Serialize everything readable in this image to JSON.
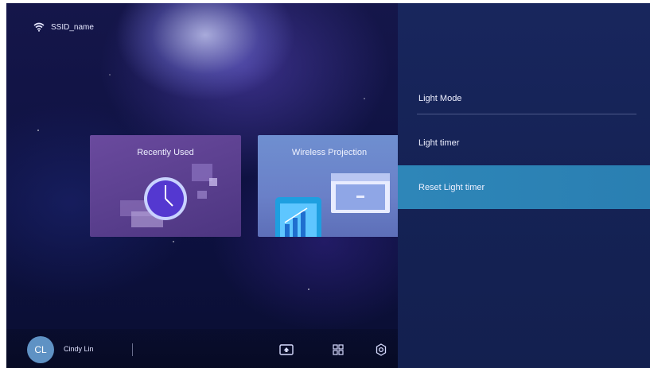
{
  "status_bar": {
    "wifi_icon": "wifi-icon",
    "ssid": "SSID_name"
  },
  "home": {
    "tiles": [
      {
        "title": "Recently Used",
        "icon": "clock-icon"
      },
      {
        "title": "Wireless Projection",
        "icon": "phone-projection-icon"
      }
    ]
  },
  "bottom_bar": {
    "user": {
      "initials": "CL",
      "name": "Cindy Lin"
    },
    "icons": [
      "input-source-icon",
      "apps-grid-icon",
      "settings-gear-icon"
    ]
  },
  "menu": {
    "items": [
      {
        "label": "Light Mode"
      },
      {
        "label": "Light timer"
      },
      {
        "label": "Reset Light timer",
        "selected": true
      }
    ]
  },
  "colors": {
    "panel": "#152255",
    "highlight": "#2a80b3",
    "avatar": "#5f92c4"
  }
}
